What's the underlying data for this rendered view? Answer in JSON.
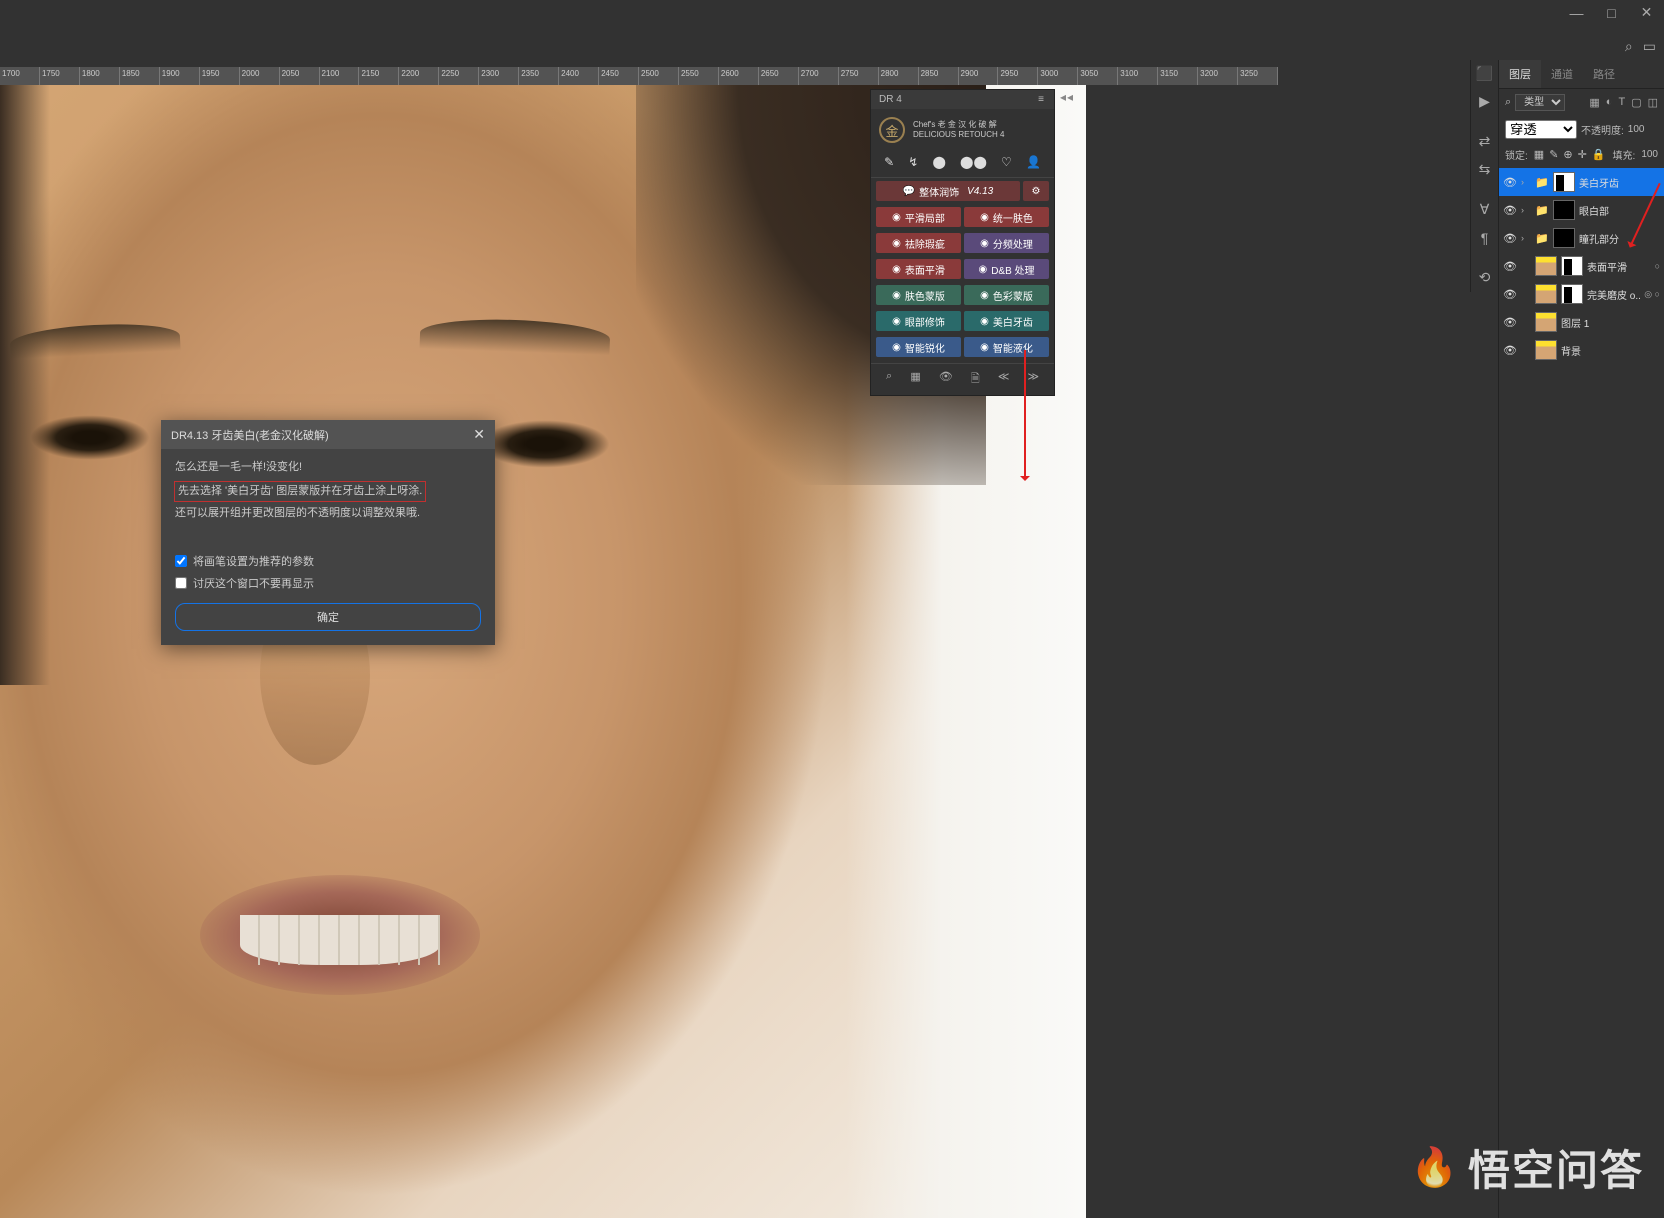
{
  "window": {
    "minimize": "—",
    "maximize": "□",
    "close": "✕"
  },
  "topright": {
    "search": "⌕",
    "close": "▭"
  },
  "ruler": {
    "ticks": [
      1700,
      1750,
      1800,
      1850,
      1900,
      1950,
      2000,
      2050,
      2100,
      2150,
      2200,
      2250,
      2300,
      2350,
      2400,
      2450,
      2500,
      2550,
      2600,
      2650,
      2700,
      2750,
      2800,
      2850,
      2900,
      2950,
      3000,
      3050,
      3100,
      3150,
      3200,
      3250
    ]
  },
  "dialog": {
    "title": "DR4.13 牙齿美白(老金汉化破解)",
    "line1": "怎么还是一毛一样!没变化!",
    "line2": "先去选择 '美白牙齿' 图层蒙版并在牙齿上涂上呀涂.",
    "line3": "还可以展开组并更改图层的不透明度以调整效果哦.",
    "check1": "将画笔设置为推荐的参数",
    "check2": "讨厌这个窗口不要再显示",
    "ok": "确定"
  },
  "dr": {
    "title": "DR 4",
    "brand1": "Chef's 老 金 汉 化 破 解",
    "brand2": "DELICIOUS RETOUCH 4",
    "logo": "金",
    "icons": [
      "✎",
      "↯",
      "⬤",
      "⬤⬤",
      "♡",
      "👤"
    ],
    "row1_a": "整体润饰",
    "row1_b": "V4.13",
    "rows": [
      {
        "a": "平滑局部",
        "ac": "red",
        "b": "统一肤色",
        "bc": "red"
      },
      {
        "a": "祛除瑕疵",
        "ac": "red",
        "b": "分频处理",
        "bc": "purple"
      },
      {
        "a": "表面平滑",
        "ac": "red",
        "b": "D&B 处理",
        "bc": "purple"
      },
      {
        "a": "肤色蒙版",
        "ac": "green",
        "b": "色彩蒙版",
        "bc": "green"
      },
      {
        "a": "眼部修饰",
        "ac": "teal",
        "b": "美白牙齿",
        "bc": "teal"
      },
      {
        "a": "智能锐化",
        "ac": "blue",
        "b": "智能液化",
        "bc": "blue"
      }
    ],
    "bottom": [
      "⌕",
      "▦",
      "👁",
      "🗎",
      "≪",
      "≫"
    ]
  },
  "sidetools": [
    "⬛",
    "▶",
    "",
    "⇄",
    "⇆",
    "",
    "Ɐ",
    "¶",
    "",
    "⟲"
  ],
  "panels": {
    "tabs": [
      "图层",
      "通道",
      "路径"
    ],
    "filter_label": "类型",
    "filter_icons": [
      "▦",
      "◐",
      "T",
      "▢",
      "◫"
    ],
    "blend": "穿透",
    "opacity_label": "不透明度:",
    "opacity_val": "100",
    "lock_label": "锁定:",
    "lock_icons": [
      "▦",
      "✎",
      "⊕",
      "✛",
      "🔒"
    ],
    "fill_label": "填充:",
    "fill_val": "100"
  },
  "layers": [
    {
      "eye": "👁",
      "chev": "›",
      "folder": "📁",
      "thumb": "mask",
      "name": "美白牙齿",
      "active": true
    },
    {
      "eye": "👁",
      "chev": "›",
      "folder": "📁",
      "thumb": "black",
      "name": "眼白部"
    },
    {
      "eye": "👁",
      "chev": "›",
      "folder": "📁",
      "thumb": "black",
      "name": "瞳孔部分"
    },
    {
      "eye": "👁",
      "chev": "",
      "folder": "",
      "thumb": "face",
      "thumb2": "mask",
      "name": "表面平滑",
      "extra": "○"
    },
    {
      "eye": "👁",
      "chev": "",
      "folder": "",
      "thumb": "face",
      "thumb2": "mask",
      "name": "完美磨皮 o...",
      "extra": "◎ ○"
    },
    {
      "eye": "👁",
      "chev": "",
      "folder": "",
      "thumb": "face",
      "name": "图层 1"
    },
    {
      "eye": "👁",
      "chev": "",
      "folder": "",
      "thumb": "face",
      "name": "背景"
    }
  ],
  "watermark": {
    "logo": "🔥",
    "text": "悟空问答"
  }
}
